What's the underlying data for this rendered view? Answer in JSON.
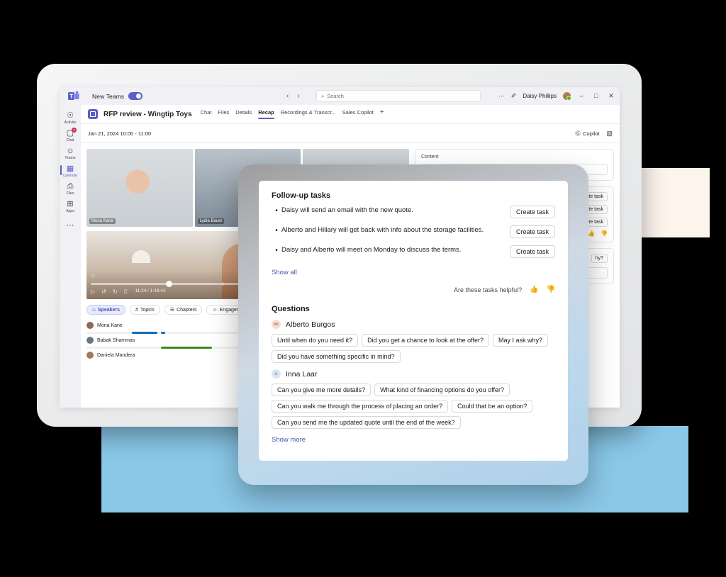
{
  "titlebar": {
    "logo_icon": "teams-logo-icon",
    "new_teams_label": "New Teams",
    "toggle_state": "on",
    "back_icon": "‹",
    "forward_icon": "›",
    "search_icon": "⌕",
    "search_placeholder": "Search",
    "search_value": "",
    "more_icon": "⋯",
    "compose_icon": "✐",
    "user_name": "Daisy Phillips",
    "minimize_icon": "–",
    "maximize_icon": "□",
    "close_icon": "✕"
  },
  "rail": {
    "items": [
      {
        "label": "Activity",
        "icon": "⌂",
        "glyph": "△",
        "badge": "",
        "active": false,
        "name": "activity"
      },
      {
        "label": "Chat",
        "icon": "chat-icon",
        "glyph": "▭",
        "badge": "2",
        "active": false,
        "name": "chat"
      },
      {
        "label": "Teams",
        "icon": "teams-icon",
        "glyph": "⚉",
        "badge": "",
        "active": false,
        "name": "teams"
      },
      {
        "label": "Calendar",
        "icon": "calendar-icon",
        "glyph": "▦",
        "badge": "",
        "active": true,
        "name": "calendar"
      },
      {
        "label": "Files",
        "icon": "files-icon",
        "glyph": "▱",
        "badge": "",
        "active": false,
        "name": "files"
      },
      {
        "label": "Apps",
        "icon": "apps-icon",
        "glyph": "⊞",
        "badge": "",
        "active": false,
        "name": "apps"
      }
    ],
    "more_icon": "⋯"
  },
  "meeting": {
    "title": "RFP review - Wingtip Toys",
    "tabs": [
      {
        "label": "Chat",
        "active": false
      },
      {
        "label": "Files",
        "active": false
      },
      {
        "label": "Details",
        "active": false
      },
      {
        "label": "Recap",
        "active": true
      },
      {
        "label": "Recordings & Transcr...",
        "active": false
      },
      {
        "label": "Sales Copilot",
        "active": false
      }
    ],
    "add_tab_icon": "+",
    "date_range": "Jan 21, 2024 10:00 - 11:00",
    "copilot_label": "Copilot",
    "copilot_icon": "Ⓖ",
    "panel_icon": "▧"
  },
  "video": {
    "tiles": [
      {
        "name": "Mona Kane"
      },
      {
        "name": "Lydia Bauer"
      },
      {
        "name": ""
      }
    ],
    "controls": {
      "people_icon": "⛬",
      "mention_icon": "@",
      "caption_icon": "⧉",
      "play_icon": "▷",
      "back10_icon": "↺",
      "fwd10_icon": "↻",
      "volume_icon": "⬯",
      "time": "11:24 / 1:48:42",
      "progress_percent": 24
    }
  },
  "filters": {
    "chips": [
      {
        "label": "Speakers",
        "icon": "⛬",
        "selected": true
      },
      {
        "label": "Topics",
        "icon": "#",
        "selected": false
      },
      {
        "label": "Chapters",
        "icon": "☰",
        "selected": false
      },
      {
        "label": "Engagement",
        "icon": "☺",
        "selected": false
      }
    ]
  },
  "speakers": [
    {
      "name": "Mona Kane",
      "color": "#0f6cbd",
      "avatar_color": "#8d6a55",
      "segments": [
        {
          "x": 14,
          "w": 8
        },
        {
          "x": 23,
          "w": 1.5
        },
        {
          "x": 55,
          "w": 9
        },
        {
          "x": 67,
          "w": 7
        },
        {
          "x": 76,
          "w": 2
        },
        {
          "x": 90,
          "w": 10
        }
      ]
    },
    {
      "name": "Babak Shammas",
      "color": "#3a8a1c",
      "avatar_color": "#6a7687",
      "segments": [
        {
          "x": 23,
          "w": 16
        },
        {
          "x": 55,
          "w": 14
        },
        {
          "x": 74,
          "w": 5
        },
        {
          "x": 89,
          "w": 11
        }
      ]
    },
    {
      "name": "Daniela Mandera",
      "color": "#a36a28",
      "avatar_color": "#a07a5e",
      "segments": []
    }
  ],
  "right_panel": {
    "content_label": "Content",
    "create_task_label": "Create task",
    "thumbs_up_icon": "ὄd",
    "thumbs_down_icon": "ὄe",
    "clipped_chip": "hy?"
  },
  "popup": {
    "followup": {
      "title": "Follow-up tasks",
      "tasks": [
        {
          "text": "Daisy will send an email with the new quote.",
          "button": "Create task"
        },
        {
          "text": "Alberto and Hillary will get back with info about the storage facilities.",
          "button": "Create task"
        },
        {
          "text": "Daisy and Alberto will meet on Monday to discuss the terms.",
          "button": "Create task"
        }
      ],
      "show_all_label": "Show all",
      "helpful_question": "Are these tasks helpful?",
      "thumbs_up_icon": "ὄd",
      "thumbs_down_icon": "ὄe"
    },
    "questions": {
      "title": "Questions",
      "people": [
        {
          "initials": "AB",
          "name": "Alberto Burgos",
          "rows": [
            [
              "Until when do you need it?",
              "Did you get a chance to look at the offer?",
              "May I ask why?"
            ],
            [
              "Did you have something specific in mind?"
            ]
          ]
        },
        {
          "initials": "IL",
          "name": "Inna Laar",
          "rows": [
            [
              "Can you give me more details?",
              "What kind of financing options do you offer?"
            ],
            [
              "Can you walk me through the process of placing an order?",
              "Could that be an option?"
            ],
            [
              "Can you send me the updated quote until the end of the week?"
            ]
          ]
        }
      ],
      "show_more_label": "Show more"
    }
  },
  "colors": {
    "brand_purple": "#5b5fc7",
    "link_blue": "#4654b0",
    "accent_blue_block": "#8ac8e8",
    "accent_cream_block": "#fdf4ec",
    "badge_red": "#c4314b"
  }
}
